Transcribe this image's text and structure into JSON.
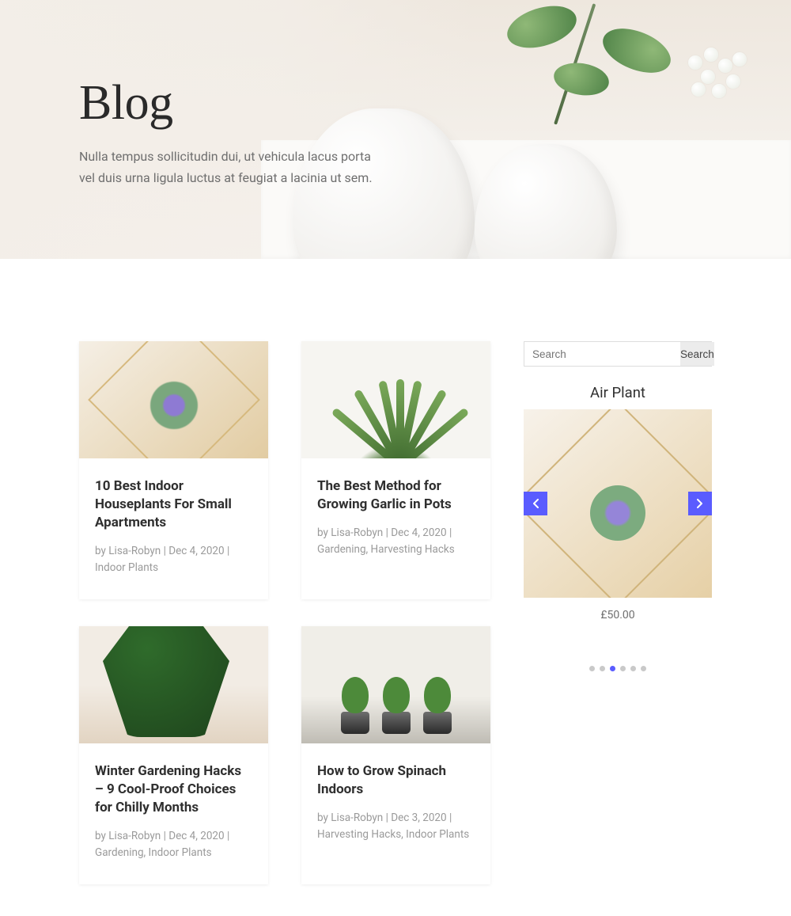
{
  "hero": {
    "title": "Blog",
    "subtitle": "Nulla tempus sollicitudin dui, ut vehicula lacus porta vel duis urna ligula luctus at feugiat a lacinia ut sem."
  },
  "labels": {
    "by": "by"
  },
  "search": {
    "placeholder": "Search",
    "button": "Search"
  },
  "posts": [
    {
      "title": "10 Best Indoor Houseplants For Small Apartments",
      "author": "Lisa-Robyn",
      "date": "Dec 4, 2020",
      "categories": "Indoor Plants"
    },
    {
      "title": "The Best Method for Growing Garlic in Pots",
      "author": "Lisa-Robyn",
      "date": "Dec 4, 2020",
      "categories": "Gardening, Harvesting Hacks"
    },
    {
      "title": "Winter Gardening Hacks – 9 Cool-Proof Choices for Chilly Months",
      "author": "Lisa-Robyn",
      "date": "Dec 4, 2020",
      "categories": "Gardening, Indoor Plants"
    },
    {
      "title": "How to Grow Spinach Indoors",
      "author": "Lisa-Robyn",
      "date": "Dec 3, 2020",
      "categories": "Harvesting Hacks, Indoor Plants"
    }
  ],
  "sidebar": {
    "product_title": "Air Plant",
    "product_price": "£50.00",
    "carousel": {
      "dot_count": 6,
      "active_index": 2
    }
  }
}
